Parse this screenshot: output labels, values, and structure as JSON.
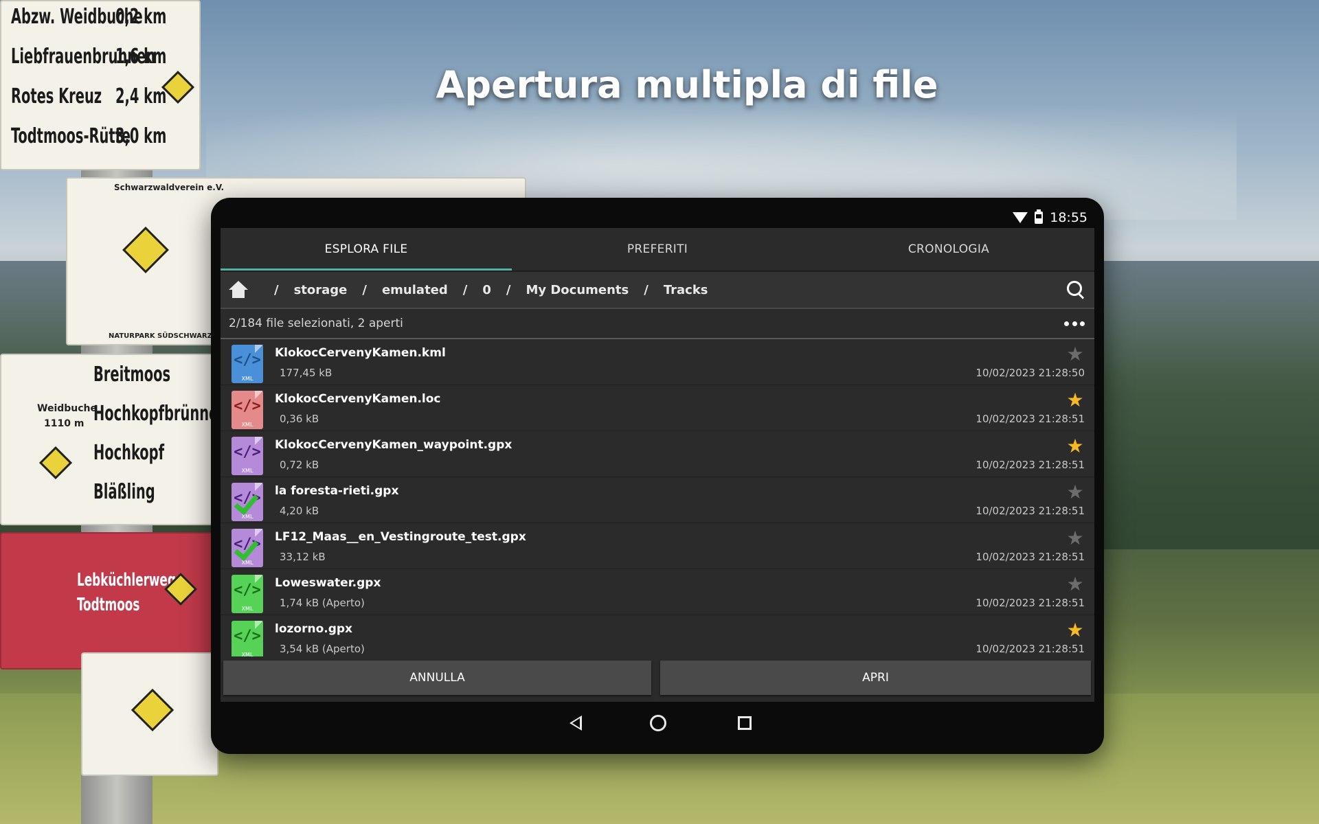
{
  "headline": "Apertura multipla di file",
  "background_signs": {
    "sign1_lines": [
      "Abzw. Weidbuche",
      "Liebfrauenbrunnen",
      "Rotes Kreuz",
      "Todtmoos-Rütte"
    ],
    "sign1_distances": [
      "0,2 km",
      "1,6 km",
      "2,4 km",
      "3,0 km"
    ],
    "sign2_header": "Schwarzwaldverein e.V.",
    "sign2_footer": "NATURPARK SÜDSCHWARZWALD",
    "sign3_place": "Weidbuche",
    "sign3_elevation": "1110 m",
    "sign3_lines": [
      "Breitmoos",
      "Hochkopfbrünnele",
      "Hochkopf",
      "Bläßling"
    ],
    "sign4_lines": [
      "Lebküchlerweg",
      "Todtmoos"
    ]
  },
  "status": {
    "time": "18:55",
    "wifi_icon": "wifi-icon",
    "battery_icon": "battery-icon"
  },
  "tabs": [
    {
      "label": "ESPLORA FILE",
      "active": true
    },
    {
      "label": "PREFERITI",
      "active": false
    },
    {
      "label": "CRONOLOGIA",
      "active": false
    }
  ],
  "breadcrumb": {
    "home_icon": "home-icon",
    "separator": "/",
    "parts": [
      "storage",
      "emulated",
      "0",
      "My Documents",
      "Tracks"
    ]
  },
  "selection_text": "2/184 file selezionati, 2 aperti",
  "files": [
    {
      "name": "KlokocCervenyKamen.kml",
      "size": "177,45 kB",
      "date": "10/02/2023 21:28:50",
      "starred": false,
      "icon_color": "#4a90d9",
      "code_color": "#1f4f8a",
      "checked": false
    },
    {
      "name": "KlokocCervenyKamen.loc",
      "size": "0,36 kB",
      "date": "10/02/2023 21:28:51",
      "starred": true,
      "icon_color": "#e58a8a",
      "code_color": "#8a1f1f",
      "checked": false
    },
    {
      "name": "KlokocCervenyKamen_waypoint.gpx",
      "size": "0,72 kB",
      "date": "10/02/2023 21:28:51",
      "starred": true,
      "icon_color": "#b48ad9",
      "code_color": "#4a1f7a",
      "checked": false
    },
    {
      "name": "la foresta-rieti.gpx",
      "size": "4,20 kB",
      "date": "10/02/2023 21:28:51",
      "starred": false,
      "icon_color": "#b48ad9",
      "code_color": "#4a1f7a",
      "checked": true
    },
    {
      "name": "LF12_Maas__en_Vestingroute_test.gpx",
      "size": "33,12 kB",
      "date": "10/02/2023 21:28:51",
      "starred": false,
      "icon_color": "#b48ad9",
      "code_color": "#4a1f7a",
      "checked": true
    },
    {
      "name": "Loweswater.gpx",
      "size": "1,74 kB (Aperto)",
      "date": "10/02/2023 21:28:51",
      "starred": false,
      "icon_color": "#56d356",
      "code_color": "#1a6e1a",
      "checked": false
    },
    {
      "name": "lozorno.gpx",
      "size": "3,54 kB (Aperto)",
      "date": "10/02/2023 21:28:51",
      "starred": true,
      "icon_color": "#56d356",
      "code_color": "#1a6e1a",
      "checked": false
    }
  ],
  "icon_glyphs": {
    "code": "</>",
    "xml": "XML",
    "star": "★"
  },
  "buttons": {
    "cancel": "ANNULLA",
    "open": "APRI"
  },
  "colors": {
    "accent": "#4fb3a9",
    "star_on": "#f7b924",
    "star_off": "#6c6c6c"
  }
}
